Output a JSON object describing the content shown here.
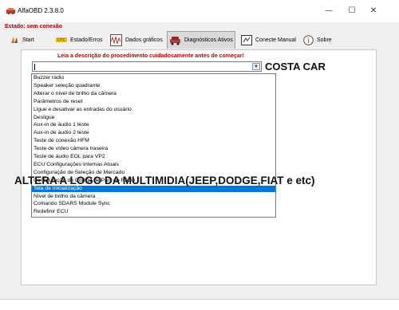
{
  "window": {
    "title": "AlfaOBD 2.3.8.0",
    "minimize_glyph": "—",
    "maximize_glyph": "☐",
    "close_glyph": "✕"
  },
  "status": "Estado: sem conexão",
  "toolbar": {
    "tabs": [
      {
        "label": "Start",
        "icon": "signal-icon"
      },
      {
        "label": "Estado/Erros",
        "icon": "dtc-icon"
      },
      {
        "label": "Dados gráficos",
        "icon": "graph-icon"
      },
      {
        "label": "Diagnósticos Ativos",
        "icon": "car-icon",
        "active": true
      },
      {
        "label": "Conecte Manual",
        "icon": "manual-connect-icon"
      },
      {
        "label": "Sobre",
        "icon": "info-icon"
      }
    ]
  },
  "main": {
    "notice": "Leia a descrição do procedimento cuidadosamente antes de começar!",
    "combo_value": "",
    "dropdown_options": [
      "Buzzer radio",
      "Speaker seleção quadrante",
      "Alterar o nível de brilho da câmera",
      "Parâmetros de reset",
      "Ligue e desativar as entradas do usuário",
      "Desligue",
      "Aux-in de áudio 1 teste",
      "Aux-in de áudio 2 teste",
      "Teste de conexão HFM",
      "Teste de vídeo câmera traseira",
      "Teste de áudio EOL para VP2",
      "ECU Configurações Internas Atuais",
      "Configuração de Seleção de Mercado",
      "Configuração de Código de País do Rádio",
      "Tela de Inicialização",
      "Nível de brilho da câmera",
      "Comando SDARS Module Sync",
      "Redefinir ECU"
    ],
    "selected_option": "Tela de Inicialização"
  },
  "overlay": {
    "costa": "COSTA CAR",
    "altera": "ALTERA A LOGO DA MULTIMIDIA(JEEP,DODGE,FIAT e etc)"
  },
  "colors": {
    "status_text": "#b00000",
    "notice_text": "#c00000",
    "selection": "#0078d7"
  }
}
